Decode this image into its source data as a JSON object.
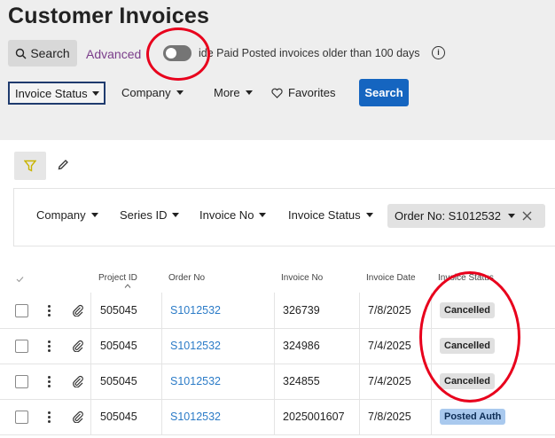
{
  "page": {
    "title": "Customer Invoices"
  },
  "search": {
    "button_label": "Search",
    "advanced_label": "Advanced",
    "hide_paid_label": "Hide Paid Posted invoices older than 100 days",
    "hide_paid_visible": "ide Paid Posted invoices older than 100 days",
    "hide_paid_toggle": "off",
    "info_glyph": "i"
  },
  "filters": {
    "invoice_status": "Invoice Status",
    "company": "Company",
    "more": "More",
    "favorites": "Favorites",
    "search_button": "Search"
  },
  "chips": {
    "company": "Company",
    "series_id": "Series ID",
    "invoice_no": "Invoice No",
    "invoice_status": "Invoice Status",
    "order_no": "Order No: S1012532"
  },
  "table": {
    "columns": [
      "Project ID",
      "Order No",
      "Invoice No",
      "Invoice Date",
      "Invoice Status"
    ],
    "sort_column": "Project ID",
    "rows": [
      {
        "project_id": "505045",
        "order_no": "S1012532",
        "invoice_no": "326739",
        "invoice_date": "7/8/2025",
        "status": "Cancelled"
      },
      {
        "project_id": "505045",
        "order_no": "S1012532",
        "invoice_no": "324986",
        "invoice_date": "7/4/2025",
        "status": "Cancelled"
      },
      {
        "project_id": "505045",
        "order_no": "S1012532",
        "invoice_no": "324855",
        "invoice_date": "7/4/2025",
        "status": "Cancelled"
      },
      {
        "project_id": "505045",
        "order_no": "S1012532",
        "invoice_no": "2025001607",
        "invoice_date": "7/8/2025",
        "status": "Posted Auth"
      }
    ]
  },
  "colors": {
    "accent": "#1565c0",
    "annotation": "#e8001c",
    "link": "#2b7bc7",
    "advanced": "#7a3d8a",
    "posted_badge": "#a9c9ee"
  }
}
